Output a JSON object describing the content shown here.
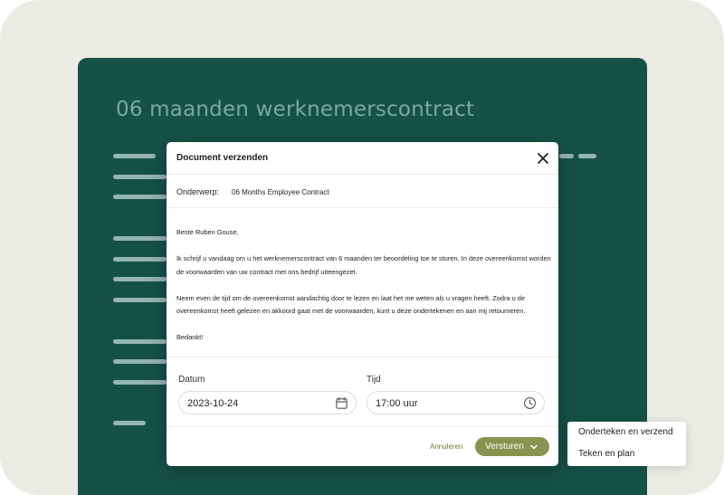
{
  "document": {
    "title": "06 maanden werknemerscontract"
  },
  "modal": {
    "title": "Document verzenden",
    "close_icon": "close-icon",
    "subject_label": "Onderwerp:",
    "subject_value": "06 Months Employee Contract",
    "body": {
      "greeting": "Beste Ruben Gouse,",
      "paragraph_1": "Ik schrijf u vandaag om u het werknemerscontract van 6 maanden ter beoordeling toe te sturen. In deze overeenkomst worden de voorwaarden van uw contract met ons bedrijf uiteengezet.",
      "paragraph_2": "Neem even de tijd om de overeenkomst aandachtig door te lezen en laat het me weten als u vragen heeft. Zodra u de overeenkomst heeft gelezen en akkoord gaat met de voorwaarden, kunt u deze ondertekenen en aan mij retourneren.",
      "closing": "Bedankt!"
    },
    "date": {
      "label": "Datum",
      "value": "2023-10-24",
      "icon": "calendar-icon"
    },
    "time": {
      "label": "Tijd",
      "value": "17:00 uur",
      "icon": "clock-icon"
    },
    "cancel_label": "Annuleren",
    "send_label": "Versturen",
    "send_icon": "chevron-down-icon"
  },
  "send_menu": {
    "items": [
      {
        "label": "Onderteken en verzend"
      },
      {
        "label": "Teken en plan"
      }
    ]
  },
  "colors": {
    "background": "#ebebe3",
    "document": "#165147",
    "accent": "#87944f"
  }
}
